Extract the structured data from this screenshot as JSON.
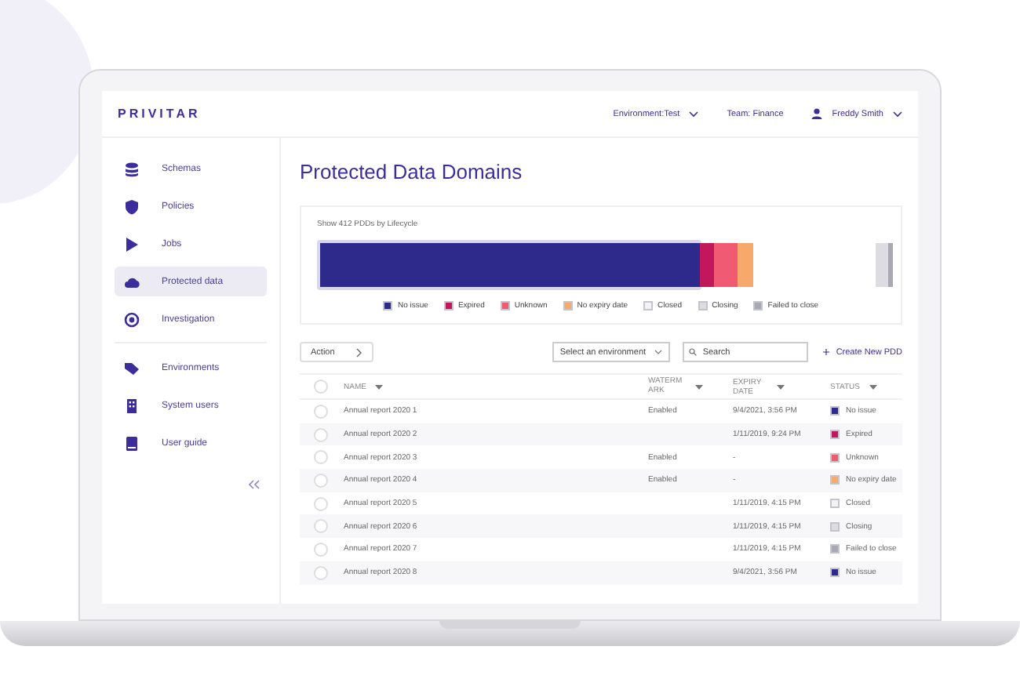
{
  "header": {
    "logo": "PRIVITAR",
    "environment": "Environment:Test",
    "team": "Team: Finance",
    "user": "Freddy Smith"
  },
  "sidebar": {
    "sections": [
      [
        {
          "label": "Schemas",
          "selected": false
        },
        {
          "label": "Policies",
          "selected": false
        },
        {
          "label": "Jobs",
          "selected": false
        },
        {
          "label": "Protected data",
          "selected": true
        },
        {
          "label": "Investigation",
          "selected": false
        }
      ],
      [
        {
          "label": "Environments",
          "selected": false
        },
        {
          "label": "System users",
          "selected": false
        },
        {
          "label": "User guide",
          "selected": false
        }
      ]
    ]
  },
  "title": "Protected Data Domains",
  "lifecycle_card": {
    "caption": "Show 412 PDDs by Lifecycle",
    "legend": [
      {
        "label": "No issue",
        "color": "#2e2a8c"
      },
      {
        "label": "Expired",
        "color": "#c2185b"
      },
      {
        "label": "Unknown",
        "color": "#f05a72"
      },
      {
        "label": "No expiry date",
        "color": "#f7a96b"
      },
      {
        "label": "Closed",
        "color": "#f3f3f6"
      },
      {
        "label": "Closing",
        "color": "#dcdce2"
      },
      {
        "label": "Failed to close",
        "color": "#a9a9b3"
      }
    ]
  },
  "toolbar": {
    "action": "Action",
    "environment_select": "Select an environment",
    "search_placeholder": "Search",
    "create": "Create New PDD"
  },
  "table": {
    "select_all_checked": false,
    "columns": [
      "NAME",
      "WATERMARK",
      "EXPIRY DATE",
      "STATUS"
    ],
    "rows": [
      {
        "checked": false,
        "name": "Annual report 2020 1",
        "watermark": "Enabled",
        "expiry": "9/4/2021, 3:56 PM",
        "status": "No issue",
        "color": "#2e2a8c"
      },
      {
        "checked": false,
        "name": "Annual report 2020 2",
        "expiry": "1/11/2019, 9:24 PM",
        "status": "Expired",
        "color": "#c2185b"
      },
      {
        "checked": false,
        "name": "Annual report 2020 3",
        "watermark": "Enabled",
        "expiry": "-",
        "status": "Unknown",
        "color": "#f05a72"
      },
      {
        "checked": false,
        "name": "Annual report 2020 4",
        "watermark": "Enabled",
        "expiry": "-",
        "status": "No expiry date",
        "color": "#f7a96b"
      },
      {
        "checked": false,
        "name": "Annual report 2020 5",
        "expiry": "1/11/2019, 4:15 PM",
        "status": "Closed",
        "color": "#f3f3f6"
      },
      {
        "checked": false,
        "name": "Annual report 2020 6",
        "expiry": "1/11/2019, 4:15 PM",
        "status": "Closing",
        "color": "#dcdce2"
      },
      {
        "checked": false,
        "name": "Annual report 2020 7",
        "expiry": "1/11/2019, 4:15 PM",
        "status": "Failed to close",
        "color": "#a9a9b3"
      },
      {
        "checked": false,
        "name": "Annual report 2020 8",
        "expiry": "9/4/2021, 3:56 PM",
        "status": "No issue",
        "color": "#2e2a8c"
      }
    ]
  }
}
